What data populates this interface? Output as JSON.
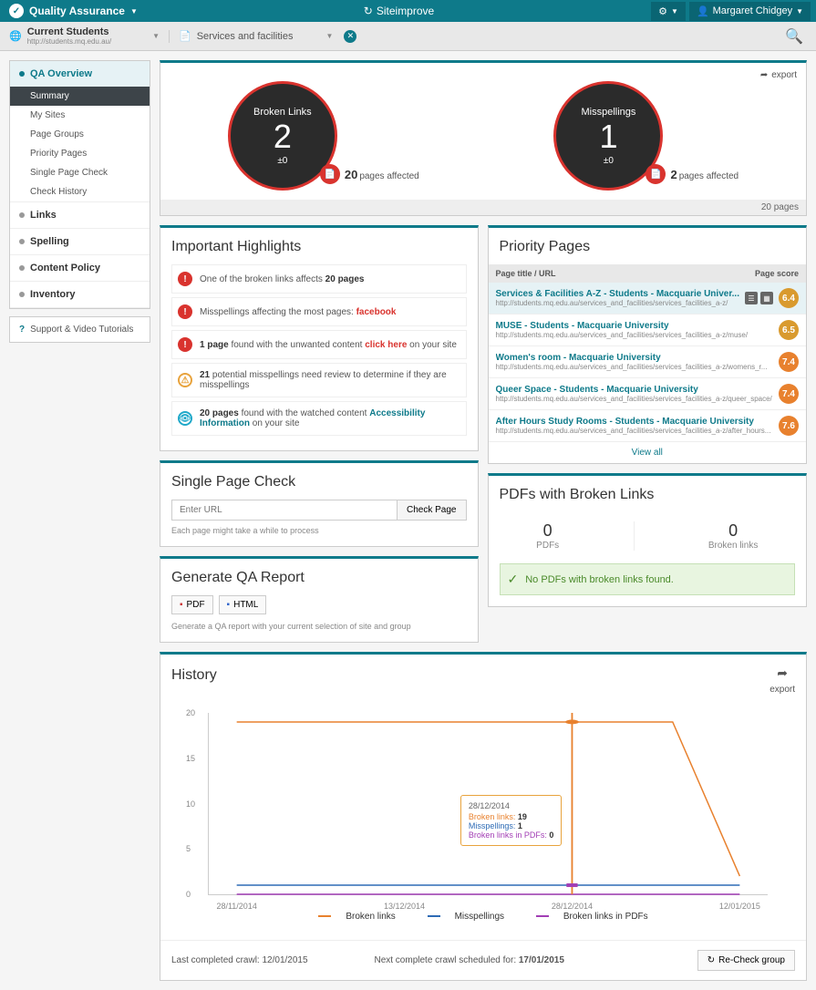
{
  "topbar": {
    "app_label": "Quality Assurance",
    "brand": "Siteimprove",
    "user_name": "Margaret Chidgey"
  },
  "filter": {
    "site_name": "Current Students",
    "site_url": "http://students.mq.edu.au/",
    "group_label": "Services and facilities"
  },
  "nav": {
    "sections": [
      {
        "label": "QA Overview",
        "active": true,
        "items": [
          {
            "label": "Summary",
            "active": true
          },
          {
            "label": "My Sites"
          },
          {
            "label": "Page Groups"
          },
          {
            "label": "Priority Pages"
          },
          {
            "label": "Single Page Check"
          },
          {
            "label": "Check History"
          }
        ]
      },
      {
        "label": "Links"
      },
      {
        "label": "Spelling"
      },
      {
        "label": "Content Policy"
      },
      {
        "label": "Inventory"
      }
    ],
    "support_label": "Support & Video Tutorials"
  },
  "summary": {
    "export_label": "export",
    "broken_links": {
      "label": "Broken Links",
      "value": "2",
      "delta": "±0",
      "pages": "20",
      "affected_label": "pages affected"
    },
    "misspellings": {
      "label": "Misspellings",
      "value": "1",
      "delta": "±0",
      "pages": "2",
      "affected_label": "pages affected"
    },
    "footer": "20 pages"
  },
  "highlights": {
    "title": "Important Highlights",
    "rows": [
      {
        "type": "red",
        "pre": "One of the broken links affects ",
        "bold": "20 pages"
      },
      {
        "type": "red",
        "pre": "Misspellings affecting the most pages: ",
        "link_red": "facebook"
      },
      {
        "type": "red",
        "bold_pre": "1 page",
        "mid": " found with the unwanted content ",
        "link_red": "click here",
        "post": " on your site"
      },
      {
        "type": "yellow",
        "bold_pre": "21",
        "mid": " potential misspellings need review to determine if they are misspellings"
      },
      {
        "type": "teal",
        "bold_pre": "20 pages",
        "mid": " found with the watched content ",
        "link_teal": "Accessibility Information",
        "post": " on your site"
      }
    ]
  },
  "priority": {
    "title": "Priority Pages",
    "col_title": "Page title / URL",
    "col_score": "Page score",
    "rows": [
      {
        "title": "Services & Facilities A-Z - Students - Macquarie Univer...",
        "url": "http://students.mq.edu.au/services_and_facilities/services_facilities_a-z/",
        "score": "6.4",
        "color": "#d99a2e",
        "icons": true
      },
      {
        "title": "MUSE - Students - Macquarie University",
        "url": "http://students.mq.edu.au/services_and_facilities/services_facilities_a-z/muse/",
        "score": "6.5",
        "color": "#d99a2e"
      },
      {
        "title": "Women's room - Macquarie University",
        "url": "http://students.mq.edu.au/services_and_facilities/services_facilities_a-z/womens_r...",
        "score": "7.4",
        "color": "#e8812e"
      },
      {
        "title": "Queer Space - Students - Macquarie University",
        "url": "http://students.mq.edu.au/services_and_facilities/services_facilities_a-z/queer_space/",
        "score": "7.4",
        "color": "#e8812e"
      },
      {
        "title": "After Hours Study Rooms - Students - Macquarie University",
        "url": "http://students.mq.edu.au/services_and_facilities/services_facilities_a-z/after_hours...",
        "score": "7.6",
        "color": "#e8812e"
      }
    ],
    "view_all": "View all"
  },
  "spc": {
    "title": "Single Page Check",
    "placeholder": "Enter URL",
    "button": "Check Page",
    "note": "Each page might take a while to process"
  },
  "report": {
    "title": "Generate QA Report",
    "pdf": "PDF",
    "html": "HTML",
    "note": "Generate a QA report with your current selection of site and group"
  },
  "pdfs": {
    "title": "PDFs with Broken Links",
    "pdfs_num": "0",
    "pdfs_label": "PDFs",
    "links_num": "0",
    "links_label": "Broken links",
    "ok_msg": "No PDFs with broken links found."
  },
  "history": {
    "title": "History",
    "export_label": "export",
    "tooltip": {
      "date": "28/12/2014",
      "bl": "19",
      "ms": "1",
      "pdf": "0"
    },
    "legend": {
      "bl": "Broken links",
      "ms": "Misspellings",
      "pdf": "Broken links in PDFs"
    },
    "crawl_done": "Last completed crawl: 12/01/2015",
    "crawl_next_pre": "Next complete crawl scheduled for: ",
    "crawl_next_date": "17/01/2015",
    "recheck": "Re-Check group"
  },
  "chart_data": {
    "type": "line",
    "x": [
      "28/11/2014",
      "13/12/2014",
      "28/12/2014",
      "12/01/2015"
    ],
    "ylim": [
      0,
      20
    ],
    "yticks": [
      0,
      5,
      10,
      15,
      20
    ],
    "series": [
      {
        "name": "Broken links",
        "color": "#e8812e",
        "values": [
          19,
          19,
          19,
          2
        ]
      },
      {
        "name": "Misspellings",
        "color": "#2e6bb5",
        "values": [
          1,
          1,
          1,
          1
        ]
      },
      {
        "name": "Broken links in PDFs",
        "color": "#a23eb5",
        "values": [
          0,
          0,
          0,
          0
        ]
      },
      {
        "name": "Broken links (prev)",
        "color": "#e8812e",
        "values_partial": [
          [
            0,
            19
          ],
          [
            0.05,
            19
          ]
        ]
      }
    ]
  }
}
